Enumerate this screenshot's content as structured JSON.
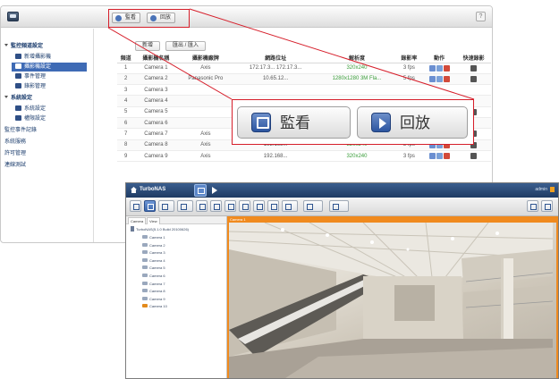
{
  "nvr": {
    "toolbar": {
      "monitor_label": "監看",
      "playback_label": "回放",
      "help": "?"
    },
    "sidebar": [
      {
        "label": "監控頻道設定",
        "kind": "group"
      },
      {
        "label": "新增攝影機",
        "kind": "item"
      },
      {
        "label": "攝影機設定",
        "kind": "item",
        "selected": true
      },
      {
        "label": "事件管理",
        "kind": "item"
      },
      {
        "label": "錄影管理",
        "kind": "item"
      },
      {
        "label": "系統設定",
        "kind": "group"
      },
      {
        "label": "系統設定",
        "kind": "item"
      },
      {
        "label": "權限設定",
        "kind": "item"
      },
      {
        "label": "監控事件記錄",
        "kind": "link"
      },
      {
        "label": "系統服務",
        "kind": "link"
      },
      {
        "label": "許可管理",
        "kind": "link"
      },
      {
        "label": "連線測試",
        "kind": "link"
      }
    ],
    "actions": {
      "add": "新增",
      "import_export": "匯出 / 匯入"
    },
    "table": {
      "headers": [
        "頻道",
        "攝影機名稱",
        "攝影機廠牌",
        "網路位址",
        "解析度",
        "錄影率",
        "動作",
        "快速錄影"
      ],
      "rows": [
        {
          "ch": "1",
          "name": "Camera 1",
          "brand": "Axis",
          "ip": "172.17.3...\n172.17.3...",
          "res": "320x240",
          "fps": "3 fps"
        },
        {
          "ch": "2",
          "name": "Camera 2",
          "brand": "Panasonic Pro",
          "ip": "10.65.12...",
          "res": "1280x1280 3M Fla...",
          "fps": "5 fps"
        },
        {
          "ch": "3",
          "name": "Camera 3",
          "brand": "",
          "ip": "",
          "res": "",
          "fps": ""
        },
        {
          "ch": "4",
          "name": "Camera 4",
          "brand": "",
          "ip": "",
          "res": "",
          "fps": ""
        },
        {
          "ch": "5",
          "name": "Camera 5",
          "brand": "",
          "ip": "192.168...",
          "res": "640x480",
          "fps": "3 fps"
        },
        {
          "ch": "6",
          "name": "Camera 6",
          "brand": "",
          "ip": "",
          "res": "",
          "fps": ""
        },
        {
          "ch": "7",
          "name": "Camera 7",
          "brand": "Axis",
          "ip": "192.168...",
          "res": "320x240",
          "fps": "3 fps"
        },
        {
          "ch": "8",
          "name": "Camera 8",
          "brand": "Axis",
          "ip": "192.168...",
          "res": "320x240",
          "fps": "3 fps"
        },
        {
          "ch": "9",
          "name": "Camera 9",
          "brand": "Axis",
          "ip": "192.168...",
          "res": "320x240",
          "fps": "3 fps"
        }
      ]
    },
    "callout": {
      "monitor_label": "監看",
      "playback_label": "回放"
    }
  },
  "viewer": {
    "brand": "TurboNAS",
    "user": "admin",
    "tree_tabs": [
      "Camera",
      "View"
    ],
    "server": "TurboNAS(5.1.0 Build 20100626)",
    "cameras": [
      "Camera 1",
      "Camera 2",
      "Camera 3",
      "Camera 4",
      "Camera 5",
      "Camera 6",
      "Camera 7",
      "Camera 8",
      "Camera 9",
      "Camera 10"
    ],
    "video_label": "Camera 1"
  },
  "colors": {
    "accent_red": "#d61e2a",
    "selected_blue": "#3f6bb5",
    "video_orange": "#f08a1e"
  }
}
